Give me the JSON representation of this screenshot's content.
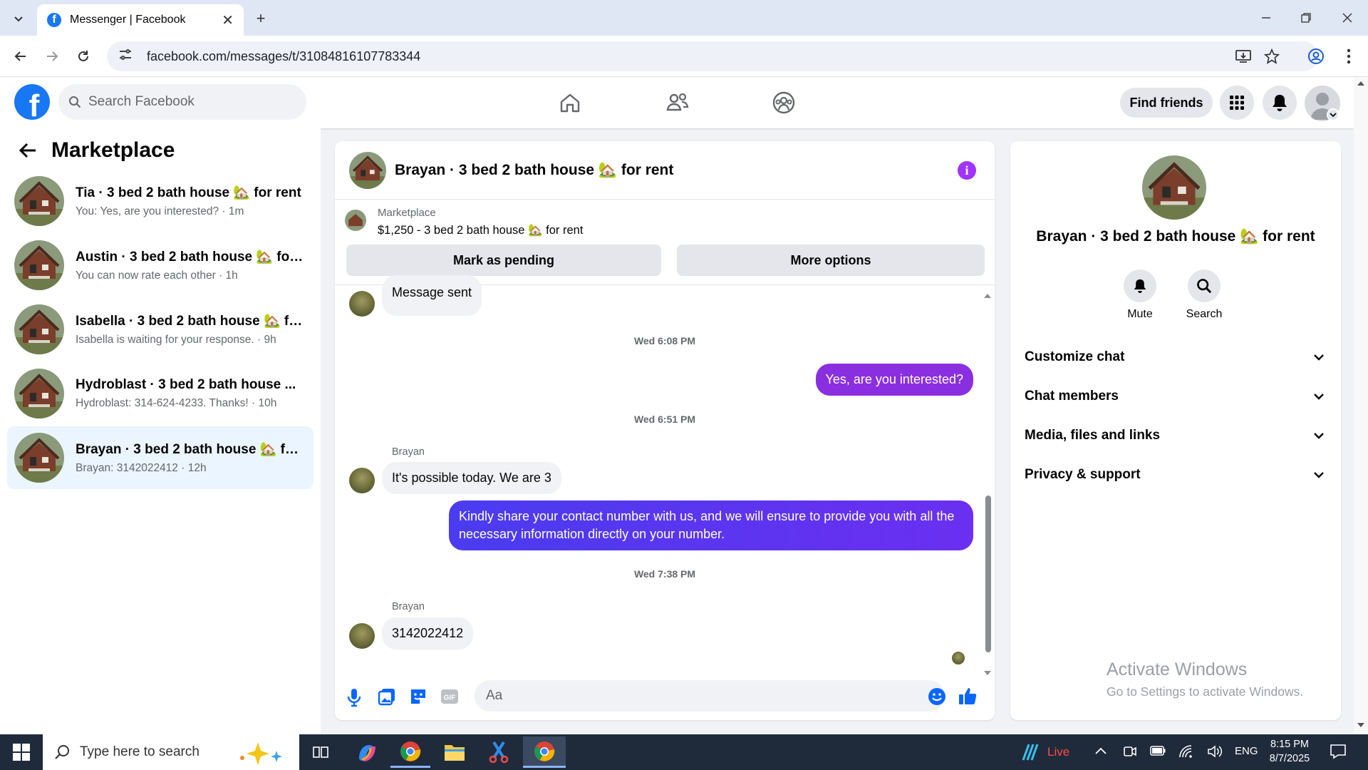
{
  "browser": {
    "tab_title": "Messenger | Facebook",
    "url": "facebook.com/messages/t/31084816107783344"
  },
  "header": {
    "search_placeholder": "Search Facebook",
    "find_friends": "Find friends"
  },
  "sidebar": {
    "title": "Marketplace",
    "conversations": [
      {
        "name": "Tia · 3 bed 2 bath house 🏡 for rent",
        "preview": "You: Yes, are you interested? · 1m"
      },
      {
        "name": "Austin · 3 bed 2 bath house 🏡 for...",
        "preview": "You can now rate each other · 1h"
      },
      {
        "name": "Isabella · 3 bed 2 bath house 🏡 fo...",
        "preview": "Isabella is waiting for your response. · 9h"
      },
      {
        "name": "Hydroblast · 3 bed 2 bath house ...",
        "preview": "Hydroblast: 314-624-4233. Thanks! · 10h"
      },
      {
        "name": "Brayan · 3 bed 2 bath house 🏡 for...",
        "preview": "Brayan: 3142022412 · 12h"
      }
    ]
  },
  "chat": {
    "title": "Brayan · 3 bed 2 bath house 🏡 for rent",
    "listing_source": "Marketplace",
    "listing_title": "$1,250 - 3 bed 2 bath house 🏡 for rent",
    "mark_pending": "Mark as pending",
    "more_options": "More options",
    "messages": {
      "m1": "Message sent",
      "t1": "Wed 6:08 PM",
      "m2": "Yes, are you interested?",
      "t2": "Wed 6:51 PM",
      "sender1": "Brayan",
      "m3": "It's possible today. We are 3",
      "m4": "Kindly share your contact number with us, and we will ensure to provide you with all the necessary information directly on your number.",
      "t3": "Wed 7:38 PM",
      "sender2": "Brayan",
      "m5": "3142022412"
    },
    "input_placeholder": "Aa"
  },
  "info_panel": {
    "name": "Brayan · 3 bed 2 bath house 🏡 for rent",
    "mute": "Mute",
    "search": "Search",
    "items": [
      "Customize chat",
      "Chat members",
      "Media, files and links",
      "Privacy & support"
    ]
  },
  "watermark": {
    "line1": "Activate Windows",
    "line2": "Go to Settings to activate Windows."
  },
  "taskbar": {
    "search_placeholder": "Type here to search",
    "live": "Live",
    "lang": "ENG",
    "time": "8:15 PM",
    "date": "8/7/2025"
  },
  "colors": {
    "fb_blue": "#1877f2",
    "accent_purple": "#a033ff",
    "active_conv": "#ebf5ff"
  }
}
